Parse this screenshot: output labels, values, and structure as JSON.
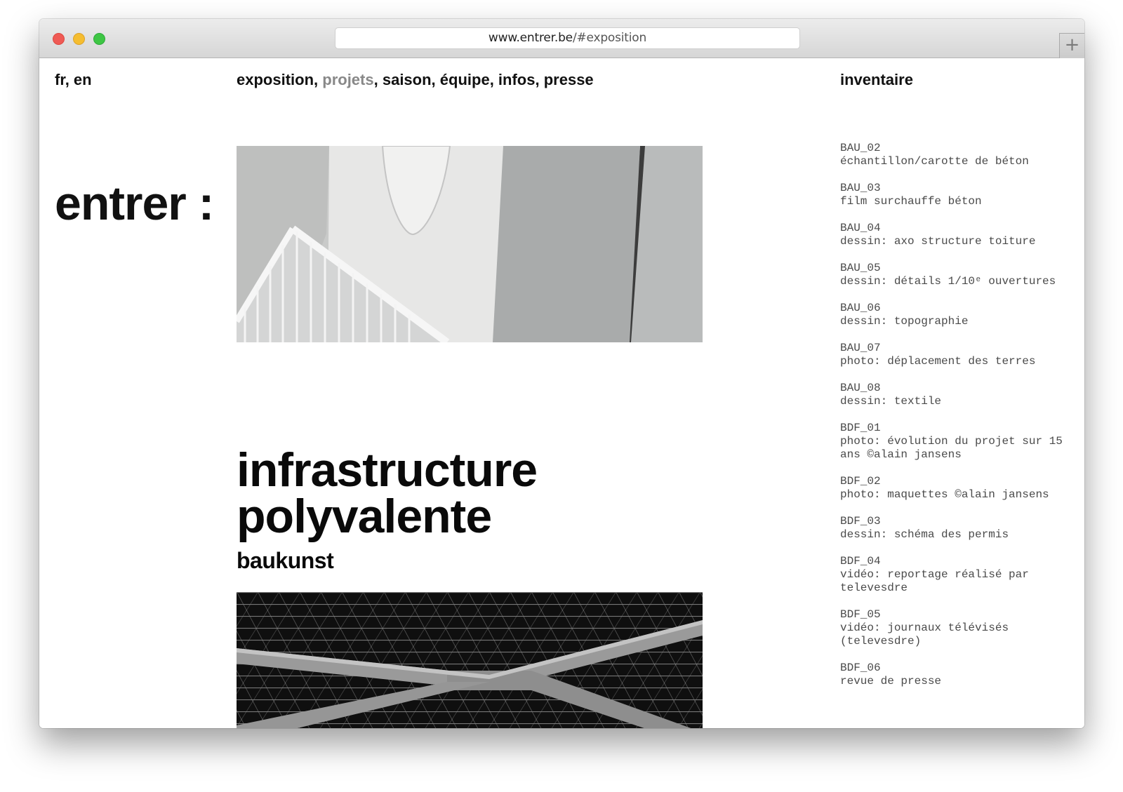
{
  "browser": {
    "url_domain": "www.entrer.be",
    "url_path": "/#exposition",
    "new_tab_symbol": "+",
    "traffic_light_colors": {
      "close": "#ef5a55",
      "minimize": "#f5bd30",
      "zoom": "#3ec644"
    }
  },
  "header": {
    "languages": [
      {
        "label": "fr",
        "sep": ", "
      },
      {
        "label": "en",
        "sep": ""
      }
    ],
    "nav": [
      {
        "label": "exposition",
        "sep": ", ",
        "active": false
      },
      {
        "label": "projets",
        "sep": ", ",
        "active": true
      },
      {
        "label": "saison",
        "sep": ", ",
        "active": false
      },
      {
        "label": "équipe",
        "sep": ", ",
        "active": false
      },
      {
        "label": "infos",
        "sep": ", ",
        "active": false
      },
      {
        "label": "presse",
        "sep": "",
        "active": false
      }
    ],
    "inventory_title": "inventaire",
    "active_color": "#888888"
  },
  "logo": "entrer :",
  "project": {
    "title_line1": "infrastructure",
    "title_line2": "polyvalente",
    "subtitle": "baukunst"
  },
  "inventory": [
    {
      "code": "BAU_02",
      "desc": "échantillon/carotte de béton"
    },
    {
      "code": "BAU_03",
      "desc": "film surchauffe béton"
    },
    {
      "code": "BAU_04",
      "desc": "dessin: axo structure toiture"
    },
    {
      "code": "BAU_05",
      "desc": "dessin: détails 1/10ᵉ ouvertures"
    },
    {
      "code": "BAU_06",
      "desc": "dessin: topographie"
    },
    {
      "code": "BAU_07",
      "desc": "photo: déplacement des terres"
    },
    {
      "code": "BAU_08",
      "desc": "dessin: textile"
    },
    {
      "code": "BDF_01",
      "desc": "photo: évolution du projet sur 15 ans ©alain jansens"
    },
    {
      "code": "BDF_02",
      "desc": "photo: maquettes ©alain jansens"
    },
    {
      "code": "BDF_03",
      "desc": "dessin: schéma des permis"
    },
    {
      "code": "BDF_04",
      "desc": "vidéo: reportage réalisé par televesdre"
    },
    {
      "code": "BDF_05",
      "desc": "vidéo: journaux télévisés (televesdre)"
    },
    {
      "code": "BDF_06",
      "desc": "revue de presse"
    }
  ]
}
